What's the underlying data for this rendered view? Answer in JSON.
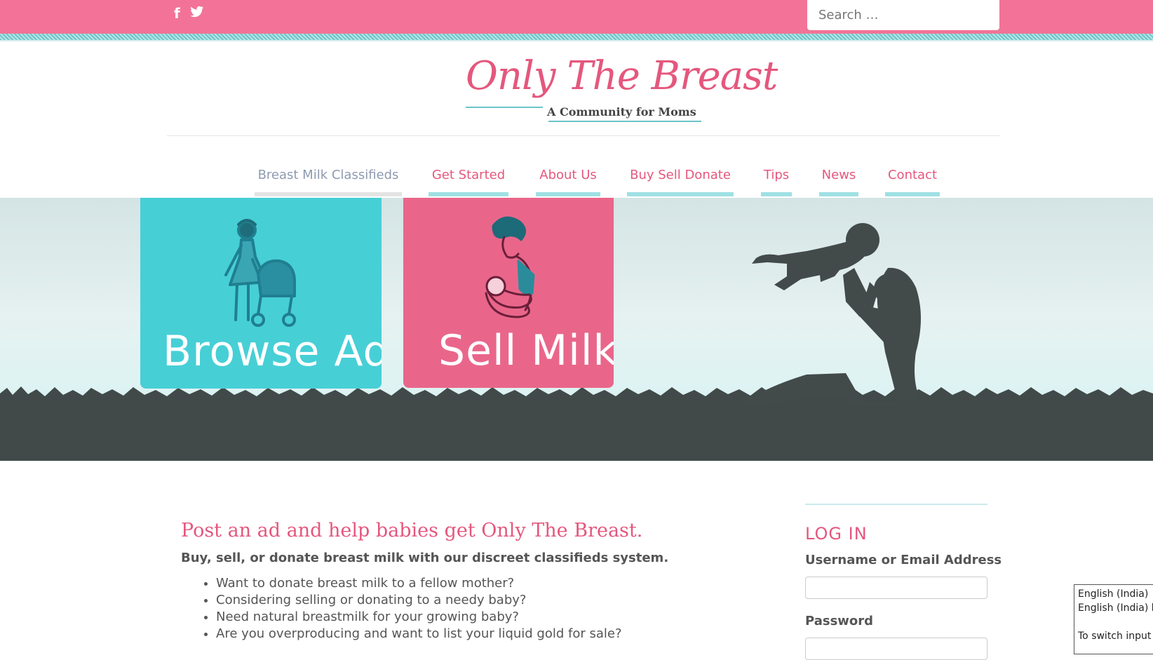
{
  "topbar": {
    "social": [
      {
        "icon": "facebook-icon",
        "glyph": "f"
      },
      {
        "icon": "twitter-icon",
        "glyph": "🐦"
      }
    ],
    "search_placeholder": "Search …"
  },
  "logo": {
    "title": "Only The Breast",
    "tagline": "A Community for Moms"
  },
  "nav": {
    "items": [
      {
        "label": "Breast Milk Classifieds",
        "active": true
      },
      {
        "label": "Get Started"
      },
      {
        "label": "About Us"
      },
      {
        "label": "Buy Sell Donate"
      },
      {
        "label": "Tips"
      },
      {
        "label": "News"
      },
      {
        "label": "Contact"
      }
    ]
  },
  "hero": {
    "browse_label": "Browse Ads",
    "sell_label": "Sell Milk"
  },
  "main": {
    "title": "Post an ad and help babies get Only The Breast.",
    "subtitle": "Buy, sell, or donate breast milk with our discreet classifieds system.",
    "bullets": [
      "Want to donate breast milk to a fellow mother?",
      "Considering selling or donating to a needy baby?",
      "Need natural breastmilk for your growing baby?",
      "Are you overproducing and want to list your liquid gold for sale?"
    ]
  },
  "sidebar": {
    "login_title": "LOG IN",
    "username_label": "Username or Email Address",
    "password_label": "Password"
  },
  "language_popup": {
    "lines": [
      "English (India)",
      "English (India) ke",
      "",
      "To switch input m"
    ]
  },
  "colors": {
    "pink": "#f27397",
    "brand_pink": "#e5577d",
    "teal": "#47cfd6",
    "dark": "#414a49"
  }
}
